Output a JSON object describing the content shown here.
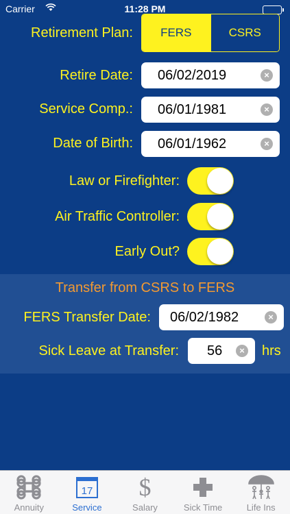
{
  "status_bar": {
    "carrier": "Carrier",
    "time": "11:28 PM"
  },
  "form": {
    "retirement_plan": {
      "label": "Retirement Plan:",
      "options": [
        "FERS",
        "CSRS"
      ],
      "selected": "FERS"
    },
    "retire_date": {
      "label": "Retire Date:",
      "value": "06/02/2019"
    },
    "service_comp": {
      "label": "Service Comp.:",
      "value": "06/01/1981"
    },
    "date_of_birth": {
      "label": "Date of Birth:",
      "value": "06/01/1962"
    },
    "law_firefighter": {
      "label": "Law or Firefighter:",
      "on": true
    },
    "air_traffic": {
      "label": "Air Traffic Controller:",
      "on": true
    },
    "early_out": {
      "label": "Early Out?",
      "on": true
    }
  },
  "transfer": {
    "title": "Transfer from CSRS to FERS",
    "fers_transfer_date": {
      "label": "FERS Transfer Date:",
      "value": "06/02/1982"
    },
    "sick_leave": {
      "label": "Sick Leave at Transfer:",
      "value": "56",
      "unit": "hrs"
    }
  },
  "tabs": [
    {
      "label": "Annuity",
      "icon": "command-icon"
    },
    {
      "label": "Service",
      "icon": "calendar-icon",
      "calendar_day": "17",
      "selected": true
    },
    {
      "label": "Salary",
      "icon": "dollar-icon"
    },
    {
      "label": "Sick Time",
      "icon": "medical-cross-icon"
    },
    {
      "label": "Life Ins",
      "icon": "umbrella-family-icon"
    }
  ],
  "colors": {
    "background": "#0c3d86",
    "accent_yellow": "#fef21f",
    "transfer_orange": "#f39a32",
    "transfer_panel": "#214f93",
    "tab_selected": "#2c6fd1"
  }
}
